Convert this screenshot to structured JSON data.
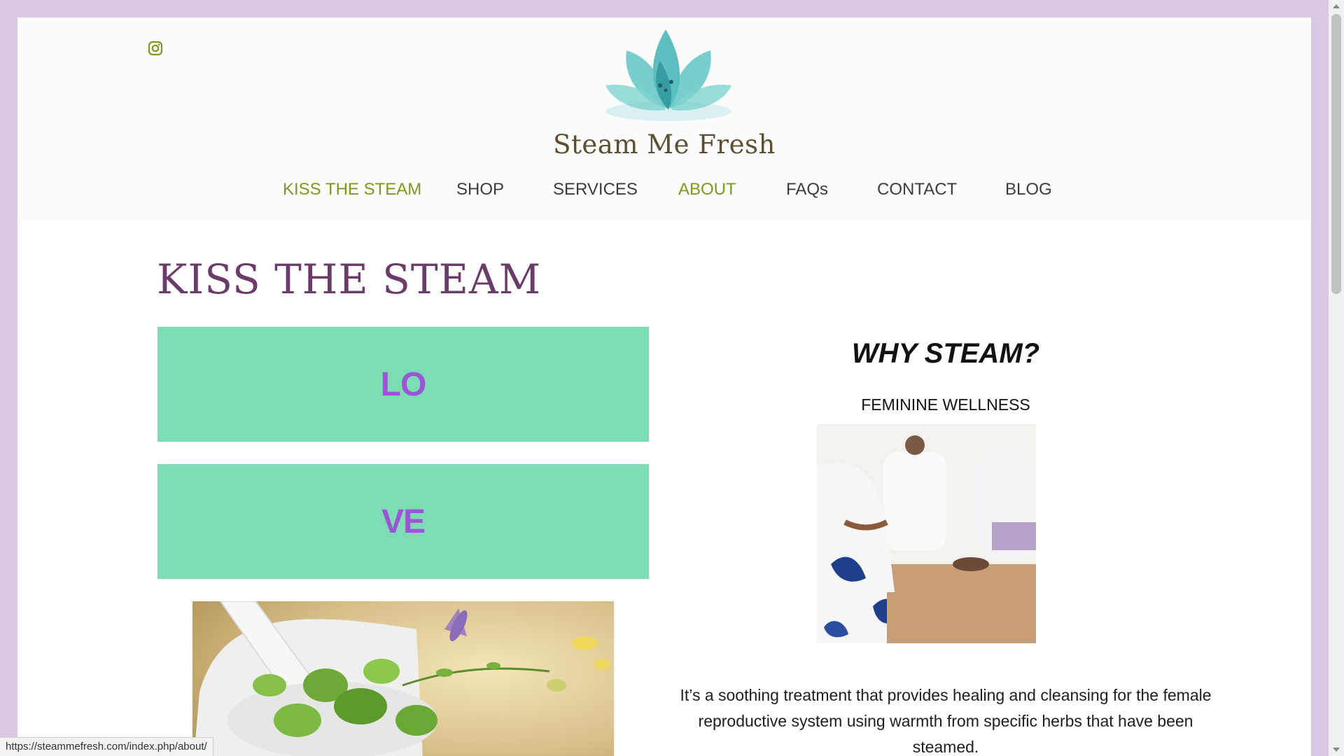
{
  "header": {
    "social": {
      "icon": "instagram-icon"
    },
    "logo": {
      "icon": "lotus-flower-logo"
    },
    "brand_name": "Steam Me Fresh",
    "nav": [
      {
        "label": "KISS THE STEAM",
        "active": true
      },
      {
        "label": "SHOP",
        "active": false
      },
      {
        "label": "SERVICES",
        "active": false
      },
      {
        "label": "ABOUT",
        "active": true
      },
      {
        "label": "FAQs",
        "active": false
      },
      {
        "label": "CONTACT",
        "active": false
      },
      {
        "label": "BLOG",
        "active": false
      }
    ]
  },
  "main": {
    "page_title": "KISS THE STEAM",
    "tiles": [
      {
        "text": "LO"
      },
      {
        "text": "VE"
      }
    ],
    "herbs_image": {
      "icon": "herbs-mortar-photo"
    },
    "why": {
      "heading": "WHY STEAM?",
      "subheading": "FEMININE WELLNESS",
      "image": {
        "icon": "women-steaming-photo"
      },
      "paragraph": "It’s a soothing treatment that provides healing and cleansing for the female reproductive system using warmth from specific herbs that have been steamed."
    }
  },
  "status_bar": {
    "url": "https://steammefresh.com/index.php/about/"
  },
  "colors": {
    "frame": "#d8c8e4",
    "nav_active": "#7a9a1e",
    "title_purple": "#6b3b6a",
    "tile_green": "#7cdcb4",
    "tile_text": "#9b55d6"
  }
}
